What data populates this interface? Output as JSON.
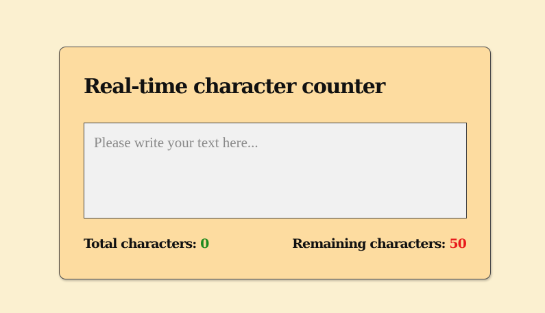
{
  "counter": {
    "title": "Real-time character counter",
    "input": {
      "value": "",
      "placeholder": "Please write your text here..."
    },
    "total": {
      "label": "Total characters: ",
      "value": "0",
      "color": "#1e8a1e"
    },
    "remaining": {
      "label": "Remaining characters: ",
      "value": "50",
      "color": "#e8191b"
    },
    "background_color": "#fddca0",
    "page_background": "#fbf0d0"
  }
}
